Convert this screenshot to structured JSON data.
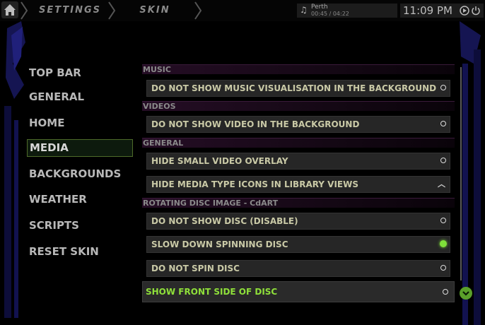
{
  "header": {
    "breadcrumbs": [
      "SETTINGS",
      "SKIN"
    ],
    "now_playing": {
      "track": "Perth",
      "time": "00:45 / 04:22"
    },
    "clock": "11:09 PM"
  },
  "sidebar": {
    "items": [
      {
        "label": "TOP BAR"
      },
      {
        "label": "GENERAL"
      },
      {
        "label": "HOME"
      },
      {
        "label": "MEDIA",
        "active": true
      },
      {
        "label": "BACKGROUNDS"
      },
      {
        "label": "WEATHER"
      },
      {
        "label": "SCRIPTS"
      },
      {
        "label": "RESET SKIN"
      }
    ]
  },
  "settings": {
    "sections": [
      {
        "title": "MUSIC",
        "rows": [
          {
            "label": "DO NOT SHOW MUSIC VISUALISATION IN THE BACKGROUND",
            "control": "radio",
            "enabled": false
          }
        ]
      },
      {
        "title": "VIDEOS",
        "rows": [
          {
            "label": "DO NOT SHOW VIDEO IN THE BACKGROUND",
            "control": "radio",
            "enabled": false
          }
        ]
      },
      {
        "title": "GENERAL",
        "rows": [
          {
            "label": "HIDE SMALL VIDEO OVERLAY",
            "control": "radio",
            "enabled": false
          },
          {
            "label": "HIDE MEDIA TYPE ICONS IN LIBRARY VIEWS",
            "control": "expand"
          }
        ]
      },
      {
        "title": "ROTATING DISC IMAGE - CdART",
        "rows": [
          {
            "label": "DO NOT SHOW DISC (DISABLE)",
            "control": "radio",
            "enabled": false
          },
          {
            "label": "SLOW DOWN SPINNING DISC",
            "control": "radio",
            "enabled": true
          },
          {
            "label": "DO NOT SPIN DISC",
            "control": "radio",
            "enabled": false
          },
          {
            "label": "SHOW FRONT SIDE OF DISC",
            "control": "radio",
            "enabled": false,
            "focused": true
          }
        ]
      }
    ]
  },
  "colors": {
    "accent_green": "#7fe03a",
    "row_text": "#c9c9a6",
    "section_bg": "#250d25",
    "deco_blue": "#1a1a6a"
  }
}
